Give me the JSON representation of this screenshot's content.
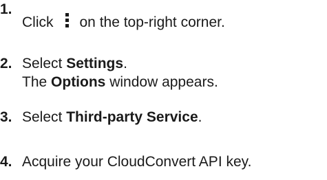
{
  "steps": [
    {
      "number": "1.",
      "prefix": "Click",
      "icon": "kebab-menu-icon",
      "suffix": "on the top-right corner."
    },
    {
      "number": "2.",
      "line1_prefix": "Select",
      "line1_bold": "Settings",
      "line1_suffix": ".",
      "line2_prefix": "The",
      "line2_bold": "Options",
      "line2_suffix": "window appears."
    },
    {
      "number": "3.",
      "prefix": "Select",
      "bold": "Third-party Service",
      "suffix": "."
    },
    {
      "number": "4.",
      "text": "Acquire your CloudConvert API key."
    }
  ]
}
